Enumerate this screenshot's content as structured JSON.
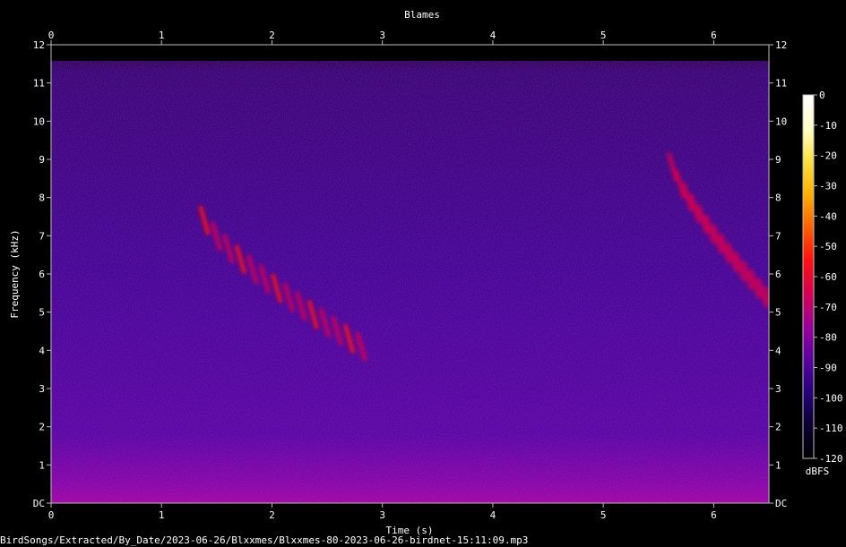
{
  "chart_data": {
    "type": "heatmap",
    "title": "Blames",
    "xlabel": "Time (s)",
    "ylabel": "Frequency (kHz)",
    "xlim": [
      0,
      6.5
    ],
    "ylim": [
      0,
      12
    ],
    "x_ticks": [
      "0",
      "1",
      "2",
      "3",
      "4",
      "5",
      "6"
    ],
    "y_ticks": [
      "DC",
      "1",
      "2",
      "3",
      "4",
      "5",
      "6",
      "7",
      "8",
      "9",
      "10",
      "11",
      "12"
    ],
    "colorbar": {
      "label": "dBFS",
      "range": [
        -120,
        0
      ],
      "ticks": [
        "0",
        "-10",
        "-20",
        "-30",
        "-40",
        "-50",
        "-60",
        "-70",
        "-80",
        "-90",
        "-100",
        "-110",
        "-120"
      ],
      "colors": [
        "#000000",
        "#0a0030",
        "#25007a",
        "#5a00a0",
        "#9a009a",
        "#d80050",
        "#ff1010",
        "#ff6000",
        "#ffb000",
        "#ffe040",
        "#ffffc8",
        "#ffffff"
      ]
    },
    "grid": false,
    "calls": [
      {
        "t_start": 1.38,
        "t_end": 2.8,
        "f_start": 7.4,
        "f_end": 4.1,
        "peak_dbfs": -60
      },
      {
        "t_start": 5.62,
        "t_end": 6.5,
        "f_start": 8.8,
        "f_end": 5.3,
        "peak_dbfs": -62
      }
    ]
  },
  "footer": {
    "file_path": "BirdSongs/Extracted/By_Date/2023-06-26/Blxxmes/Blxxmes-80-2023-06-26-birdnet-15:11:09.mp3"
  }
}
